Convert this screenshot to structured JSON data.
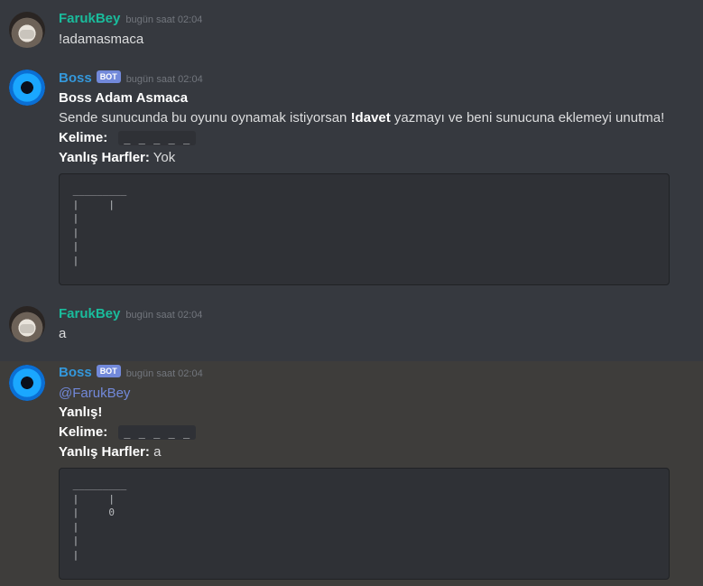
{
  "messages": [
    {
      "author": "FarukBey",
      "timestamp": "bugün saat 02:04",
      "text": "!adamasmaca"
    },
    {
      "author": "Boss",
      "badge": "BOT",
      "timestamp": "bugün saat 02:04",
      "title": "Boss Adam Asmaca",
      "invite_prefix": "Sende sunucunda bu oyunu oynamak istiyorsan ",
      "invite_command": "!davet",
      "invite_suffix": " yazmayı ve beni sunucuna eklemeyi unutma!",
      "word_label": "Kelime:",
      "word_value": "_ _ _ _ _",
      "wrong_label": "Yanlış Harfler:",
      "wrong_value": "Yok",
      "gallows": " _________\n |     |\n |\n |\n |\n |"
    },
    {
      "author": "FarukBey",
      "timestamp": "bugün saat 02:04",
      "text": "a"
    },
    {
      "author": "Boss",
      "badge": "BOT",
      "timestamp": "bugün saat 02:04",
      "mention": "@FarukBey",
      "result": "Yanlış!",
      "word_label": "Kelime:",
      "word_value": "_ _ _ _ _",
      "wrong_label": "Yanlış Harfler:",
      "wrong_value": "a",
      "gallows": " _________\n |     |\n |     0\n |\n |\n |"
    }
  ],
  "colors": {
    "background": "#36393f",
    "highlight_background": "#3e3d3b",
    "faruk_name": "#1abc9c",
    "boss_name": "#3498db",
    "bot_badge": "#7289da",
    "codeblock": "#2f3136"
  }
}
